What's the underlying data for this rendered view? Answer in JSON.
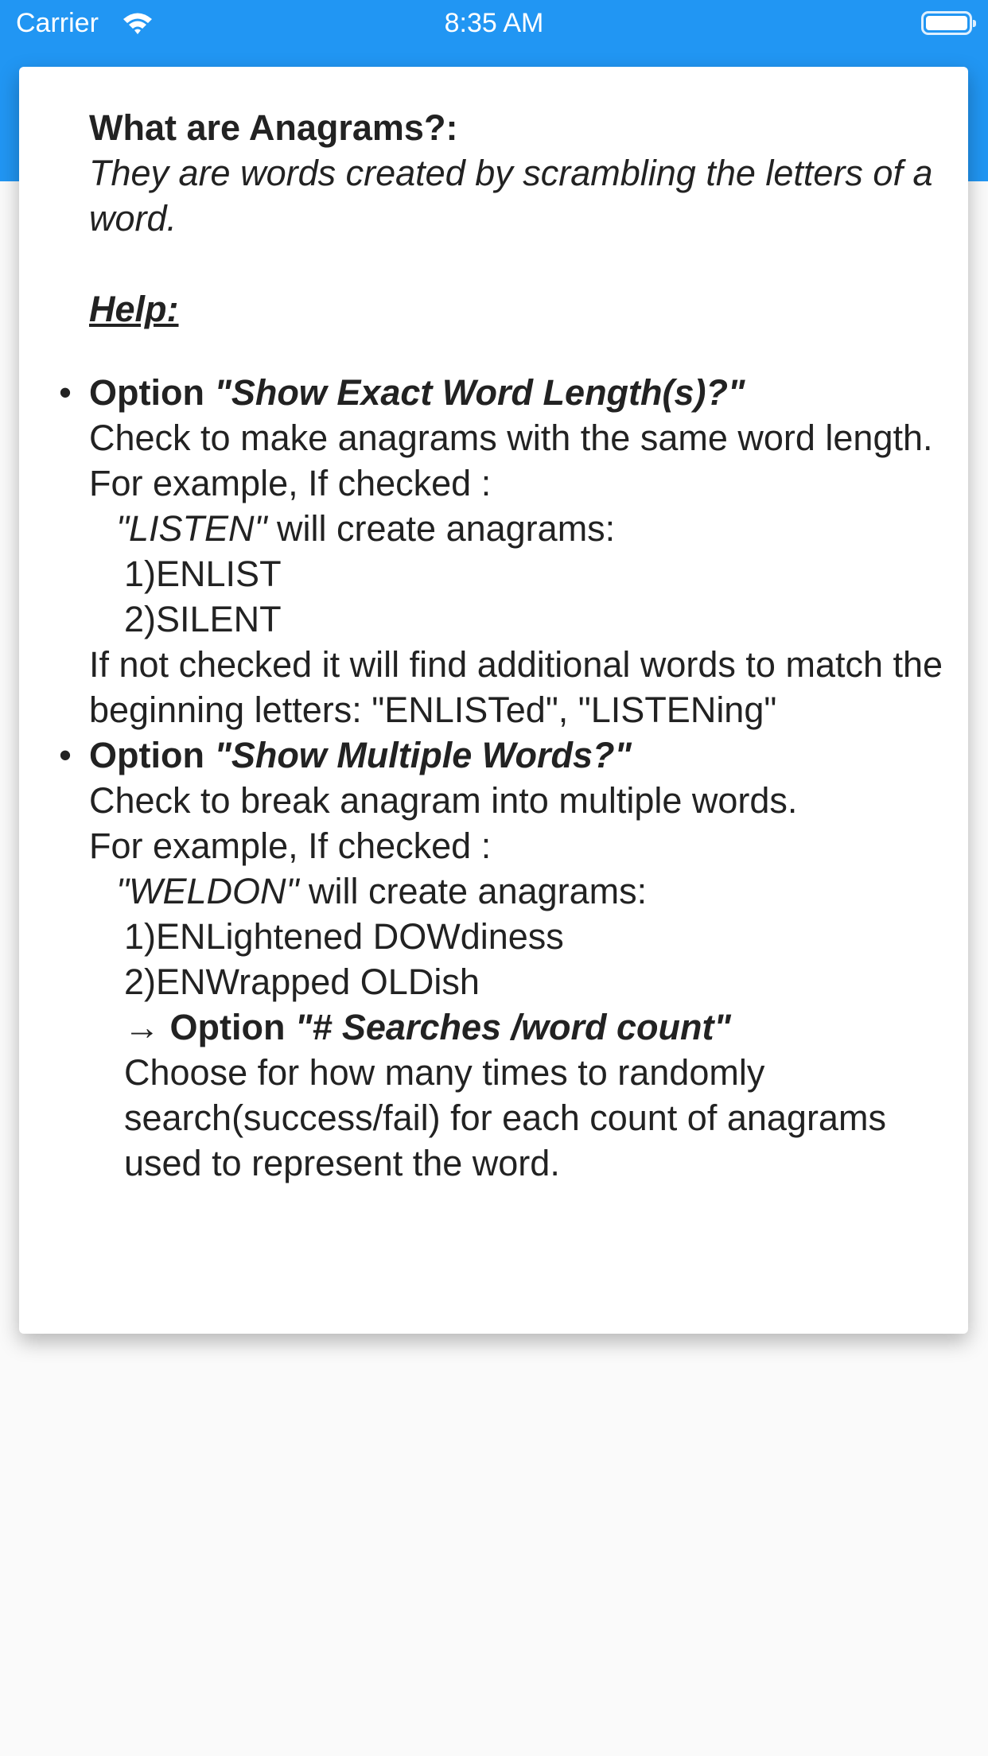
{
  "status_bar": {
    "carrier": "Carrier",
    "time": "8:35 AM"
  },
  "help_card": {
    "heading": "What are Anagrams?:",
    "definition": "They are words created by scrambling the letters of a word.",
    "help_label": "Help:",
    "option1": {
      "prefix": "Option",
      "name": "\"Show Exact Word Length(s)?\"",
      "description": "Check to make anagrams with the same word length.",
      "example_intro": "For example, If checked :",
      "example_word": "\"LISTEN\"",
      "example_suffix": "will create anagrams:",
      "results": [
        "1)ENLIST",
        "2)SILENT"
      ],
      "not_checked": "If not checked it will find additional words to match the beginning letters: \"ENLISTed\", \"LISTENing\""
    },
    "option2": {
      "prefix": "Option",
      "name": "\"Show Multiple Words?\"",
      "description": "Check to break anagram into multiple words.",
      "example_intro": "For example, If checked :",
      "example_word": "\"WELDON\"",
      "example_suffix": "will create anagrams:",
      "results": [
        "1)ENLightened DOWdiness",
        "2)ENWrapped OLDish"
      ],
      "sub_option": {
        "arrow": "→",
        "prefix": "Option",
        "name": "\"# Searches /word count\"",
        "description": "Choose for how many times to randomly search(success/fail) for each count of anagrams used to represent the word."
      }
    }
  },
  "colors": {
    "app_bar": "#2196f3",
    "background": "#fafafa",
    "card": "#ffffff",
    "text": "#222222"
  }
}
